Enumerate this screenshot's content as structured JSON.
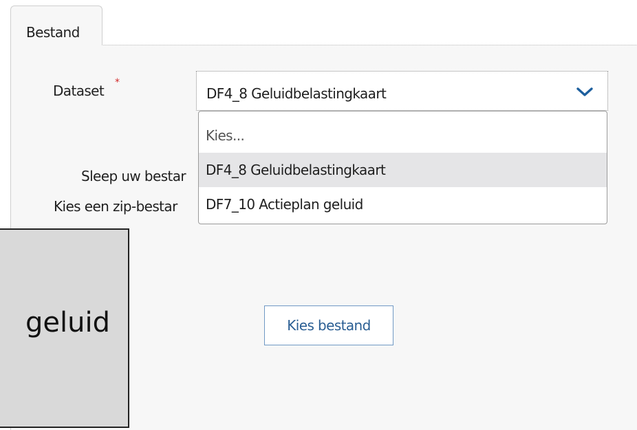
{
  "tabs": [
    {
      "label": "Bestand"
    }
  ],
  "form": {
    "dataset_label": "Dataset",
    "required_marker": "*",
    "selected_value": "DF4_8 Geluidbelastingkaart"
  },
  "dropdown": {
    "options": [
      {
        "label": "Kies..."
      },
      {
        "label": "DF4_8 Geluidbelastingkaart",
        "selected": true
      },
      {
        "label": "DF7_10 Actieplan geluid"
      }
    ]
  },
  "dropzone": {
    "line1": "Sleep uw bestar",
    "line2": "Kies een zip-bestar",
    "button_label": "Kies bestand"
  },
  "zoom_overlay": {
    "text": "geluid"
  },
  "icons": {
    "select_chevron": "chevron-down-icon"
  },
  "colors": {
    "accent": "#1d5f9e",
    "required": "#d22a2a",
    "selected_option_bg": "#e5e5e7",
    "button_text": "#2a5e93"
  }
}
